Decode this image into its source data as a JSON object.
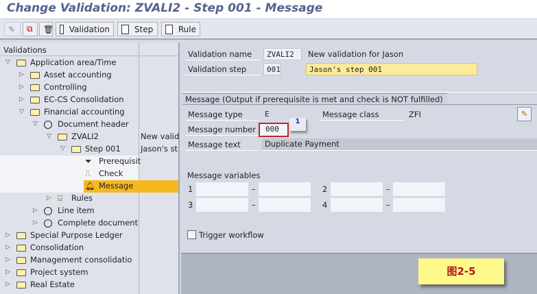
{
  "title": "Change Validation: ZVALI2 - Step 001 - Message",
  "toolbar": {
    "validation": "Validation",
    "step": "Step",
    "rule": "Rule"
  },
  "tree": {
    "header": "Validations",
    "items": [
      {
        "label": "Application area/Time"
      },
      {
        "label": "Asset accounting"
      },
      {
        "label": "Controlling"
      },
      {
        "label": "EC-CS Consolidation"
      },
      {
        "label": "Financial accounting"
      },
      {
        "label": "Document header"
      },
      {
        "label": "ZVALI2",
        "desc": "New valid"
      },
      {
        "label": "Step 001",
        "desc": "Jason's st"
      },
      {
        "label": "Prerequisit"
      },
      {
        "label": "Check"
      },
      {
        "label": "Message"
      },
      {
        "label": "Rules"
      },
      {
        "label": "Line item"
      },
      {
        "label": "Complete document"
      },
      {
        "label": "Special Purpose Ledger"
      },
      {
        "label": "Consolidation"
      },
      {
        "label": "Management consolidatio"
      },
      {
        "label": "Project system"
      },
      {
        "label": "Real Estate"
      }
    ]
  },
  "header": {
    "name_label": "Validation name",
    "name_value": "ZVALI2",
    "name_desc": "New validation for Jason",
    "step_label": "Validation step",
    "step_value": "001",
    "step_desc": "Jason's step 001"
  },
  "message": {
    "group_title": "Message (Output if prerequisite is met and check is NOT fulfilled)",
    "type_label": "Message type",
    "type_value": "E",
    "class_label": "Message class",
    "class_value": "ZFI",
    "number_label": "Message number",
    "number_value": "000",
    "callout": "1",
    "text_label": "Message text",
    "text_value": "Duplicate Payment",
    "vars_label": "Message variables",
    "vars": [
      "1",
      "2",
      "3",
      "4"
    ],
    "dash": "–",
    "workflow_label": "Trigger workflow"
  },
  "figure_label": "图2-5"
}
